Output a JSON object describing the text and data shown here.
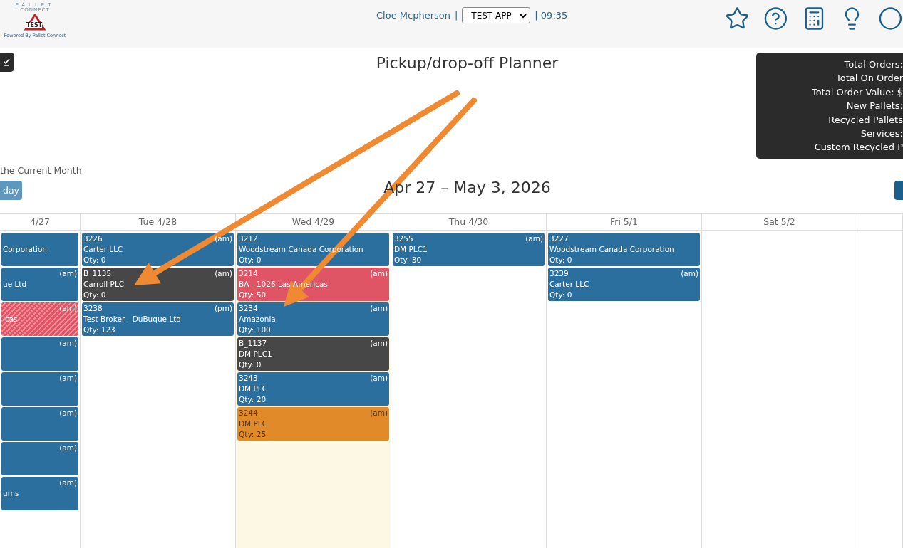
{
  "header": {
    "logo": {
      "line1": "PALLET",
      "line2": "CONNECT",
      "badge": "TEST"
    },
    "tagline": "Powered By Pallet Connect",
    "user": "Cloe Mcpherson",
    "separator": "|",
    "app_select": "TEST APP",
    "time": "| 09:35"
  },
  "title": "Pickup/drop-off Planner",
  "stats": [
    "Total Orders:",
    "Total On Order",
    "Total Order Value: $",
    "New Pallets:",
    "Recycled Pallets",
    "Services:",
    "Custom Recycled P"
  ],
  "month_note": "the Current Month",
  "today_button": "day",
  "date_range": "Apr 27 – May 3, 2026",
  "days": [
    {
      "label": "4/27",
      "today": false,
      "events": [
        {
          "customer": "Corporation",
          "color": "#2b6f9f"
        },
        {
          "slot": "(am)",
          "customer": "ue Ltd",
          "color": "#2b6f9f"
        },
        {
          "slot": "(am)",
          "customer": "icas",
          "color": "#e05565",
          "striped": true
        },
        {
          "slot": "(am)",
          "color": "#2b6f9f"
        },
        {
          "slot": "(am)",
          "color": "#2b6f9f"
        },
        {
          "slot": "(am)",
          "color": "#2b6f9f"
        },
        {
          "slot": "(am)",
          "color": "#2b6f9f"
        },
        {
          "slot": "(am)",
          "customer": "ums",
          "color": "#2b6f9f"
        }
      ]
    },
    {
      "label": "Tue 4/28",
      "today": false,
      "events": [
        {
          "id": "3226",
          "slot": "(am)",
          "customer": "Carter LLC",
          "qty": "Qty: 0",
          "color": "#2b6f9f"
        },
        {
          "id": "B_1135",
          "slot": "(am)",
          "customer": "Carroll PLC",
          "qty": "Qty: 0",
          "color": "#474747"
        },
        {
          "id": "3238",
          "slot": "(pm)",
          "customer": "Test Broker - DuBuque Ltd",
          "qty": "Qty: 123",
          "color": "#2b6f9f"
        }
      ]
    },
    {
      "label": "Wed 4/29",
      "today": true,
      "events": [
        {
          "id": "3212",
          "customer": "Woodstream Canada Corporation",
          "qty": "Qty: 0",
          "color": "#2b6f9f"
        },
        {
          "id": "3214",
          "slot": "(am)",
          "customer": "BA - 1026 Las Americas",
          "qty": "Qty: 50",
          "color": "#e05565"
        },
        {
          "id": "3234",
          "slot": "(am)",
          "customer": "Amazonia",
          "qty": "Qty: 100",
          "color": "#2b6f9f"
        },
        {
          "id": "B_1137",
          "slot": "(am)",
          "customer": "DM PLC1",
          "qty": "Qty: 0",
          "color": "#474747"
        },
        {
          "id": "3243",
          "slot": "(am)",
          "customer": "DM PLC",
          "qty": "Qty: 20",
          "color": "#2b6f9f"
        },
        {
          "id": "3244",
          "slot": "(am)",
          "customer": "DM PLC",
          "qty": "Qty: 25",
          "color": "#e08a2a"
        }
      ]
    },
    {
      "label": "Thu 4/30",
      "today": false,
      "events": [
        {
          "id": "3255",
          "slot": "(am)",
          "customer": "DM PLC1",
          "qty": "Qty: 30",
          "color": "#2b6f9f"
        }
      ]
    },
    {
      "label": "Fri 5/1",
      "today": false,
      "events": [
        {
          "id": "3227",
          "customer": "Woodstream Canada Corporation",
          "qty": "Qty: 0",
          "color": "#2b6f9f"
        },
        {
          "id": "3239",
          "slot": "(am)",
          "customer": "Carter LLC",
          "qty": "Qty: 0",
          "color": "#2b6f9f"
        }
      ]
    },
    {
      "label": "Sat 5/2",
      "today": false
    },
    {
      "today": false
    }
  ]
}
